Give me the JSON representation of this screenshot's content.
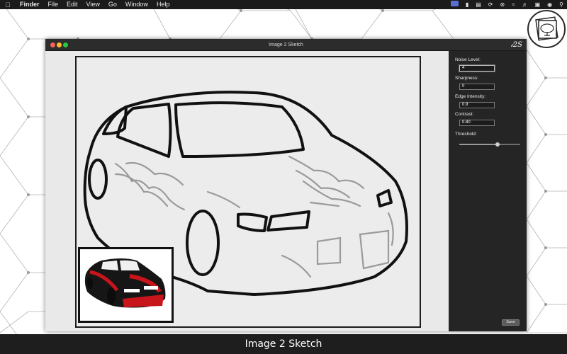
{
  "menubar": {
    "apple_icon": "apple-icon",
    "app_name": "Finder",
    "menus": [
      "File",
      "Edit",
      "View",
      "Go",
      "Window",
      "Help"
    ],
    "status_icons": [
      "notification-icon",
      "battery-icon",
      "time-machine-icon",
      "bluetooth-icon",
      "wifi-icon",
      "volume-icon",
      "display-icon",
      "user-icon",
      "search-icon"
    ]
  },
  "window": {
    "title": "Image 2 Sketch",
    "logo_text": "i2S"
  },
  "panel": {
    "noise_level": {
      "label": "Noise Level:",
      "value": "4"
    },
    "sharpness": {
      "label": "Sharpness:",
      "value": "0"
    },
    "edge_intensity": {
      "label": "Edge Intensity:",
      "value": "0.9"
    },
    "contrast": {
      "label": "Contrast:",
      "value": "0.80"
    },
    "threshold": {
      "label": "Threshold:",
      "level_fraction": 0.63
    },
    "save_label": "Save"
  },
  "caption": "Image 2 Sketch",
  "colors": {
    "desktop_bg": "#ffffff",
    "pattern_line": "#b4b4b4",
    "window_bg": "#3a3a3a",
    "panel_bg": "#252525",
    "canvas_bg": "#e9e9e9",
    "thumbnail_red": "#c8151b"
  }
}
